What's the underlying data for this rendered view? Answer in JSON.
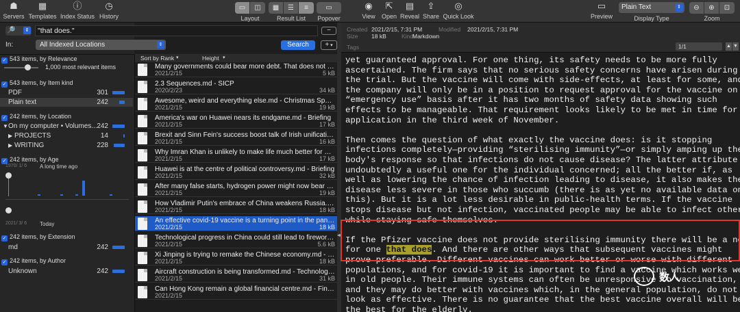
{
  "toolbar": {
    "servers": "Servers",
    "templates": "Templates",
    "index_status": "Index Status",
    "history": "History",
    "layout": "Layout",
    "result_list": "Result List",
    "popover": "Popover",
    "view": "View",
    "open": "Open",
    "reveal": "Reveal",
    "share": "Share",
    "quick_look": "Quick Look",
    "preview": "Preview",
    "display_type": "Display Type",
    "display_value": "Plain Text",
    "zoom": "Zoom"
  },
  "search": {
    "query": "\"that does.\"",
    "in_label": "In:",
    "location": "All Indexed Locations",
    "search_button": "Search",
    "add_button": "+"
  },
  "facets": {
    "relevance_header": "543 items, by Relevance",
    "relevance_value": "1,000 most relevant items",
    "kind_header": "543 items, by Item kind",
    "kind": [
      {
        "label": "PDF",
        "count": "301",
        "bar": 18
      },
      {
        "label": "Plain text",
        "count": "242",
        "bar": 8
      }
    ],
    "location_header": "242 items, by Location",
    "locations": [
      {
        "label": "On my computer • Volumes...",
        "count": "242",
        "bar": 18
      },
      {
        "label": "PROJECTS",
        "count": "14",
        "bar": 2
      },
      {
        "label": "WRITING",
        "count": "228",
        "bar": 16
      }
    ],
    "age_header": "242 items, by Age",
    "age_top": "1970/ 1/ 6",
    "age_top_label": "A long time ago",
    "age_bottom": "2021/ 3/ 6",
    "age_bottom_label": "Today",
    "extension_header": "242 items, by Extension",
    "extension": [
      {
        "label": "md",
        "count": "242",
        "bar": 18
      }
    ],
    "author_header": "242 items, by Author",
    "author": [
      {
        "label": "Unknown",
        "count": "242",
        "bar": 18
      }
    ]
  },
  "results": {
    "sort_label": "Sort by Rank",
    "height_label": "Height",
    "rows": [
      {
        "title": "Many governments could bear more debt. That does not mea...",
        "date": "2021/2/15",
        "size": "5 kB"
      },
      {
        "title": "2.3 Sequences.md - SICP",
        "date": "2020/2/23",
        "size": "34 kB"
      },
      {
        "title": "Awesome, weird and everything else.md - Christmas Specials",
        "date": "2021/2/15",
        "size": "19 kB"
      },
      {
        "title": "America's war on Huawei nears its endgame.md - Briefing",
        "date": "2021/2/15",
        "size": "17 kB"
      },
      {
        "title": "Brexit and Sinn Fein's success boost talk of Irish unification.m...",
        "date": "2021/2/15",
        "size": "16 kB"
      },
      {
        "title": "Why Imran Khan is unlikely to make life much better for Pakist...",
        "date": "2021/2/15",
        "size": "17 kB"
      },
      {
        "title": "Huawei is at the centre of political controversy.md - Briefing",
        "date": "2021/2/15",
        "size": "32 kB"
      },
      {
        "title": "After many false starts, hydrogen power might now bear fruit...",
        "date": "2021/2/15",
        "size": "19 kB"
      },
      {
        "title": "How Vladimir Putin's embrace of China weakens Russia.md -...",
        "date": "2021/2/15",
        "size": "18 kB"
      },
      {
        "title": "An effective covid-19 vaccine is a turning point in the pande...",
        "date": "2021/2/15",
        "size": "18 kB"
      },
      {
        "title": "Technological progress in China could still lead to fireworks.m...",
        "date": "2021/2/15",
        "size": "5.6 kB"
      },
      {
        "title": "Xi Jinping is trying to remake the Chinese economy.md - Brief...",
        "date": "2021/2/15",
        "size": "18 kB"
      },
      {
        "title": "Aircraft construction is being transformed.md - Technology Q...",
        "date": "2021/2/15",
        "size": "31 kB"
      },
      {
        "title": "Can Hong Kong remain a global financial centre.md - Finance...",
        "date": "2021/2/15",
        "size": ""
      }
    ]
  },
  "meta": {
    "created_label": "Created",
    "created": "2021/2/15, 7:31 PM",
    "modified_label": "Modified",
    "modified": "2021/2/15, 7:31 PM",
    "size_label": "Size",
    "size": "18 kB",
    "kind_label": "Kind",
    "kind": "Markdown",
    "tags_label": "Tags",
    "page": "1/1"
  },
  "preview": {
    "lines": [
      "yet guaranteed approval. For one thing, its safety needs to be more fully",
      "ascertained. The firm says that no serious safety concerns have arisen during",
      "the trial. But the vaccine will come with side-effects, at least for some, and",
      "the company will only be in a position to request approval for the vaccine on a",
      "“emergency use” basis after it has two months of safety data showing such",
      "effects to be manageable. That requirement looks likely to be met in time for a",
      "application in the third week of November.",
      "",
      "Then comes the question of what exactly the vaccine does: is it stopping",
      "infections completely—providing “sterilising immunity”—or simply amping up the",
      "body's response so that infections do not cause disease? The latter attribute i",
      "undoubtedly a useful one for the individual concerned; all the better if, as",
      "well as lowering the chance of infection leading to disease, it also makes the",
      "disease less severe in those who succumb (there is as yet no available data on",
      "this). But it is a lot less desirable in public-health terms. If the vaccine",
      "stops disease but not infection, vaccinated people may be able to infect others",
      "while staying safe themselves.",
      "",
      "If the Pfizer vaccine does not provide sterilising immunity there will be a nee"
    ],
    "hl_before": "for one ",
    "hl_text": "that does",
    "hl_after": ". And there are other ways that subsequent vaccines might",
    "lines_after": [
      "prove preferable. Different vaccines can work better or worse with different",
      "populations, and for covid-19 it is important to find a vaccine which works wel",
      "in old people. Their immune systems can often be unresponsive to vaccination,",
      "and they may do better with vaccines which, in the general population, do not",
      "look as effective. There is no guarantee that the best vaccine overall will be",
      "the best for the elderly."
    ]
  },
  "watermark": "数人"
}
